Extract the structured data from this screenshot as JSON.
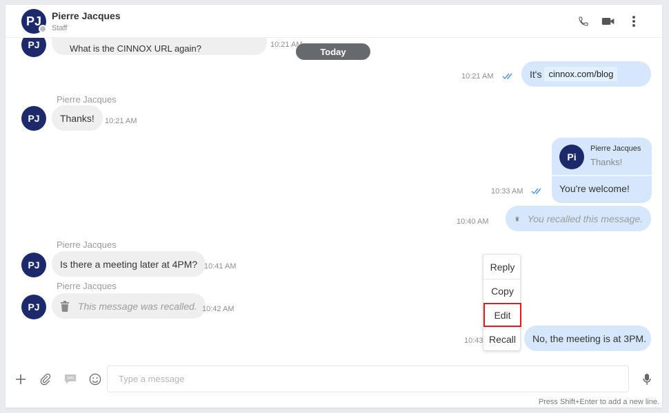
{
  "header": {
    "avatar_initials": "PJ",
    "name": "Pierre Jacques",
    "subtitle": "Staff",
    "icons": [
      "phone-icon",
      "video-camera-icon",
      "more-vertical-icon"
    ]
  },
  "colors": {
    "avatar_bg": "#1c2a6b",
    "incoming_bubble": "#efefef",
    "outgoing_bubble": "#d6e7fb",
    "read_ticks": "#4a90e2",
    "today_pill": "#666a6e",
    "menu_highlight": "#e01b1b"
  },
  "divider": {
    "today_label": "Today"
  },
  "messages": {
    "m1": {
      "avatar": "PJ",
      "text": "What is the CINNOX URL again?",
      "time": "10:21 AM"
    },
    "m2": {
      "prefix": "It's",
      "link": "cinnox.com/blog",
      "time": "10:21 AM"
    },
    "m3": {
      "sender": "Pierre Jacques",
      "avatar": "PJ",
      "text": "Thanks!",
      "time": "10:21 AM"
    },
    "m4": {
      "quote_avatar": "Pi",
      "quote_sender": "Pierre Jacques",
      "quote_text": "Thanks!",
      "text": "You're welcome!",
      "time": "10:33 AM"
    },
    "m5": {
      "text": "You recalled this message.",
      "time": "10:40 AM"
    },
    "m6": {
      "sender": "Pierre Jacques",
      "avatar": "PJ",
      "text": "Is there a meeting later at 4PM?",
      "time": "10:41 AM"
    },
    "m7": {
      "sender": "Pierre Jacques",
      "avatar": "PJ",
      "text": "This message was recalled.",
      "time": "10:42 AM"
    },
    "m8": {
      "text": "No, the meeting is at 3PM.",
      "time": "10:43"
    }
  },
  "context_menu": {
    "items": [
      "Reply",
      "Copy",
      "Edit",
      "Recall"
    ],
    "highlighted": "Edit"
  },
  "composer": {
    "placeholder": "Type a message",
    "hint": "Press Shift+Enter to add a new line.",
    "icons": [
      "plus-icon",
      "paperclip-icon",
      "sms-icon",
      "emoji-icon",
      "microphone-icon"
    ]
  }
}
